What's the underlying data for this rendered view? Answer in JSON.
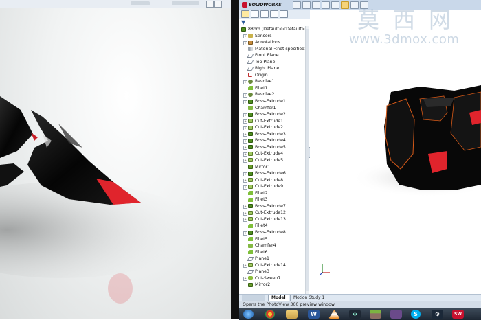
{
  "app": {
    "logo_text": "SOLIDWORKS",
    "status_text": "Opens the PhotoView 360 preview window."
  },
  "feature_tree": {
    "root": "88bm  (Default<<Default>",
    "items": [
      {
        "label": "Sensors",
        "icon": "sensors-icon",
        "expandable": true
      },
      {
        "label": "Annotations",
        "icon": "annotations-icon",
        "expandable": true
      },
      {
        "label": "Material <not specified>",
        "icon": "material-icon",
        "expandable": false
      },
      {
        "label": "Front Plane",
        "icon": "plane-icon",
        "expandable": false
      },
      {
        "label": "Top Plane",
        "icon": "plane-icon",
        "expandable": false
      },
      {
        "label": "Right Plane",
        "icon": "plane-icon",
        "expandable": false
      },
      {
        "label": "Origin",
        "icon": "origin-icon",
        "expandable": false
      },
      {
        "label": "Revolve1",
        "icon": "revolve-icon",
        "expandable": true
      },
      {
        "label": "Fillet1",
        "icon": "fillet-icon",
        "expandable": false
      },
      {
        "label": "Revolve2",
        "icon": "revolve-icon",
        "expandable": true
      },
      {
        "label": "Boss-Extrude1",
        "icon": "boss-extrude-icon",
        "expandable": true
      },
      {
        "label": "Chamfer1",
        "icon": "chamfer-icon",
        "expandable": false
      },
      {
        "label": "Boss-Extrude2",
        "icon": "boss-extrude-icon",
        "expandable": true
      },
      {
        "label": "Cut-Extrude1",
        "icon": "cut-extrude-icon",
        "expandable": true
      },
      {
        "label": "Cut-Extrude2",
        "icon": "cut-extrude-icon",
        "expandable": true
      },
      {
        "label": "Boss-Extrude3",
        "icon": "boss-extrude-icon",
        "expandable": true
      },
      {
        "label": "Boss-Extrude4",
        "icon": "boss-extrude-icon",
        "expandable": true
      },
      {
        "label": "Boss-Extrude5",
        "icon": "boss-extrude-icon",
        "expandable": true
      },
      {
        "label": "Cut-Extrude4",
        "icon": "cut-extrude-icon",
        "expandable": true
      },
      {
        "label": "Cut-Extrude5",
        "icon": "cut-extrude-icon",
        "expandable": true
      },
      {
        "label": "Mirror1",
        "icon": "mirror-icon",
        "expandable": false
      },
      {
        "label": "Boss-Extrude6",
        "icon": "boss-extrude-icon",
        "expandable": true
      },
      {
        "label": "Cut-Extrude8",
        "icon": "cut-extrude-icon",
        "expandable": true
      },
      {
        "label": "Cut-Extrude9",
        "icon": "cut-extrude-icon",
        "expandable": true
      },
      {
        "label": "Fillet2",
        "icon": "fillet-icon",
        "expandable": false
      },
      {
        "label": "Fillet3",
        "icon": "fillet-icon",
        "expandable": false
      },
      {
        "label": "Boss-Extrude7",
        "icon": "boss-extrude-icon",
        "expandable": true
      },
      {
        "label": "Cut-Extrude12",
        "icon": "cut-extrude-icon",
        "expandable": true
      },
      {
        "label": "Cut-Extrude13",
        "icon": "cut-extrude-icon",
        "expandable": true
      },
      {
        "label": "Fillet4",
        "icon": "fillet-icon",
        "expandable": false
      },
      {
        "label": "Boss-Extrude8",
        "icon": "boss-extrude-icon",
        "expandable": true
      },
      {
        "label": "Fillet5",
        "icon": "fillet-icon",
        "expandable": false
      },
      {
        "label": "Chamfer4",
        "icon": "chamfer-icon",
        "expandable": false
      },
      {
        "label": "Fillet6",
        "icon": "fillet-icon",
        "expandable": false
      },
      {
        "label": "Plane1",
        "icon": "plane-icon",
        "expandable": false
      },
      {
        "label": "Cut-Extrude14",
        "icon": "cut-extrude-icon",
        "expandable": true
      },
      {
        "label": "Plane3",
        "icon": "plane-icon",
        "expandable": false
      },
      {
        "label": "Cut-Sweep7",
        "icon": "cut-sweep-icon",
        "expandable": true
      },
      {
        "label": "Mirror2",
        "icon": "mirror-icon",
        "expandable": false
      }
    ]
  },
  "bottom_tabs": {
    "model": "Model",
    "motion_study": "Motion Study 1"
  },
  "taskbar": {
    "icons": [
      "windows-start-icon",
      "chrome-icon",
      "file-explorer-icon",
      "word-icon",
      "vlc-icon",
      "network-app-icon",
      "minecraft-icon",
      "app-icon",
      "skype-icon",
      "steam-icon",
      "solidworks-taskbar-icon"
    ]
  },
  "watermark": {
    "cn": "莫西网",
    "url": "www.3dmox.com"
  },
  "colors": {
    "accent_red": "#e0242c",
    "model_black": "#0a0a0a",
    "panel_bg": "#ffffff",
    "toolbar_bg": "#c9d8ea"
  }
}
